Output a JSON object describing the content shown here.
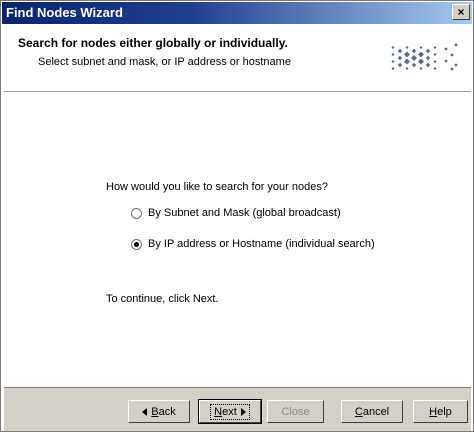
{
  "window": {
    "title": "Find Nodes Wizard",
    "close_glyph": "×"
  },
  "header": {
    "title": "Search for nodes either globally or individually.",
    "subtitle": "Select subnet and mask, or IP address or hostname",
    "logo_icon": "diamond-dots-logo"
  },
  "content": {
    "question": "How would you like to search for your nodes?",
    "options": [
      {
        "label": "By Subnet and Mask (global broadcast)",
        "selected": false
      },
      {
        "label": "By IP address or Hostname (individual search)",
        "selected": true
      }
    ],
    "continue_text": "To continue, click Next."
  },
  "footer": {
    "back": {
      "mnemonic": "B",
      "rest": "ack"
    },
    "next": {
      "mnemonic": "N",
      "rest": "ext"
    },
    "close": {
      "label": "Close",
      "enabled": false
    },
    "cancel": {
      "mnemonic": "C",
      "rest": "ancel"
    },
    "help": {
      "mnemonic": "H",
      "rest": "elp"
    }
  },
  "colors": {
    "title_bar_start": "#0a246a",
    "title_bar_end": "#a6caf0",
    "logo_color": "#5a6a8e",
    "footer_bg": "#d4d0c8"
  }
}
